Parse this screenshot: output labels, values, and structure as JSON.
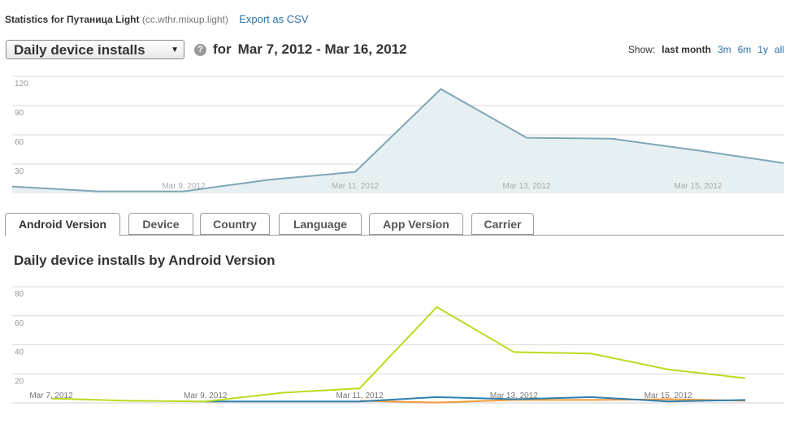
{
  "header": {
    "title_prefix": "Statistics for Путаница Light",
    "package": "(cc.wthr.mixup.light)",
    "export_label": "Export as CSV"
  },
  "metric": {
    "selected": "Daily device installs",
    "for_label": "for",
    "date_range": "Mar 7, 2012 - Mar 16, 2012",
    "help_glyph": "?"
  },
  "range_selector": {
    "label": "Show:",
    "active": "last month",
    "options": [
      "3m",
      "6m",
      "1y",
      "all"
    ]
  },
  "colors": {
    "main_line": "#7fa6b5",
    "main_fill": "#e6eff2",
    "grid": "#d9d9d9",
    "link": "#2a6fa8",
    "series_green": "#b7dc1f",
    "series_blue": "#2f7fb0",
    "series_orange": "#f29a3a"
  },
  "main_chart": {
    "y_ticks": [
      "120",
      "90",
      "60",
      "30"
    ],
    "x_ticks": [
      "Mar 9, 2012",
      "Mar 11, 2012",
      "Mar 13, 2012",
      "Mar 15, 2012"
    ]
  },
  "tabs": [
    "Android Version",
    "Device",
    "Country",
    "Language",
    "App Version",
    "Carrier"
  ],
  "active_tab": "Android Version",
  "section_title": "Daily device installs by Android Version",
  "chart_data": [
    {
      "type": "area",
      "x": [
        "Mar 7, 2012",
        "Mar 8, 2012",
        "Mar 9, 2012",
        "Mar 10, 2012",
        "Mar 11, 2012",
        "Mar 12, 2012",
        "Mar 13, 2012",
        "Mar 14, 2012",
        "Mar 15, 2012",
        "Mar 16, 2012"
      ],
      "series": [
        {
          "values": [
            7,
            2,
            2,
            14,
            22,
            107,
            57,
            56,
            44,
            31
          ]
        }
      ],
      "ylim": [
        0,
        120
      ],
      "y_ticks": [
        30,
        60,
        90,
        120
      ],
      "grid": true
    },
    {
      "type": "line",
      "x": [
        "Mar 7, 2012",
        "Mar 8, 2012",
        "Mar 9, 2012",
        "Mar 10, 2012",
        "Mar 11, 2012",
        "Mar 12, 2012",
        "Mar 13, 2012",
        "Mar 14, 2012",
        "Mar 15, 2012",
        "Mar 16, 2012"
      ],
      "x_tick_labels": [
        "Mar 7, 2012",
        "Mar 9, 2012",
        "Mar 11, 2012",
        "Mar 13, 2012",
        "Mar 15, 2012"
      ],
      "series": [
        {
          "values": [
            3,
            1.5,
            1,
            7,
            10,
            66,
            35,
            34,
            23,
            17
          ]
        },
        {
          "values": [
            null,
            null,
            1,
            1,
            1,
            4,
            2.5,
            4,
            1,
            2
          ]
        },
        {
          "values": [
            null,
            null,
            null,
            null,
            1.5,
            0.2,
            2,
            2,
            2.5,
            1.5
          ]
        }
      ],
      "ylim": [
        0,
        80
      ],
      "y_ticks": [
        20,
        40,
        60,
        80
      ],
      "grid": true
    }
  ]
}
